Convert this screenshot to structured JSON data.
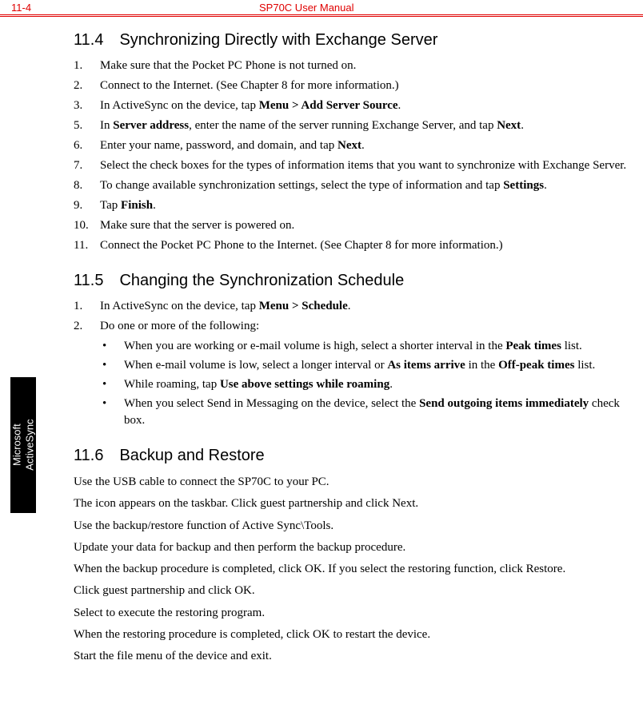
{
  "header": {
    "page_num": "11-4",
    "title": "SP70C User Manual"
  },
  "sidetab": {
    "line1": "Microsoft",
    "line2": "ActiveSync"
  },
  "s114": {
    "heading": "11.4 Synchronizing Directly with Exchange Server",
    "steps": [
      {
        "n": "1.",
        "pre": "Make sure that the Pocket PC Phone is not turned on."
      },
      {
        "n": "2.",
        "pre": "Connect to the Internet. (See Chapter 8 for more information.)"
      },
      {
        "n": "3.",
        "pre": "In ActiveSync on the device, tap ",
        "b1": "Menu > Add Server Source",
        "post1": "."
      },
      {
        "n": "5.",
        "pre": "In ",
        "b1": "Server address",
        "post1": ", enter the name of the server running Exchange Server, and tap ",
        "b2": "Next",
        "post2": "."
      },
      {
        "n": "6.",
        "pre": "Enter your name, password, and domain, and tap ",
        "b1": "Next",
        "post1": "."
      },
      {
        "n": "7.",
        "pre": "Select the check boxes for the types of information items that you want to synchronize with Exchange Server."
      },
      {
        "n": "8.",
        "pre": "To change available synchronization settings, select the type of information and tap ",
        "b1": "Settings",
        "post1": "."
      },
      {
        "n": "9.",
        "pre": "Tap ",
        "b1": "Finish",
        "post1": "."
      },
      {
        "n": "10.",
        "pre": "Make sure that the server is powered on."
      },
      {
        "n": "11.",
        "pre": "Connect the Pocket PC Phone to the Internet. (See Chapter 8 for more information.)"
      }
    ]
  },
  "s115": {
    "heading": "11.5 Changing the Synchronization Schedule",
    "steps": [
      {
        "n": "1.",
        "pre": "In ActiveSync on the device, tap ",
        "b1": "Menu > Schedule",
        "post1": "."
      },
      {
        "n": "2.",
        "pre": "Do one or more of the following:"
      }
    ],
    "bullets": [
      {
        "pre": "When you are working or e-mail volume is high, select a shorter interval in the ",
        "b1": "Peak times",
        "post1": " list."
      },
      {
        "pre": "When e-mail volume is low, select a longer interval or ",
        "b1": "As items arrive",
        "post1": " in the ",
        "b2": "Off-peak times",
        "post2": " list."
      },
      {
        "pre": "While roaming, tap ",
        "b1": "Use above settings while roaming",
        "post1": "."
      },
      {
        "pre": "When you select Send in Messaging on the device, select the ",
        "b1": "Send outgoing items immediately",
        "post1": " check box."
      }
    ]
  },
  "s116": {
    "heading": "11.6 Backup and Restore",
    "paras": [
      "Use the USB cable to connect the SP70C to your PC.",
      "The  icon appears on the taskbar. Click guest partnership and click Next.",
      "Use the backup/restore function of Active Sync\\Tools.",
      "Update your data for backup and then perform the backup procedure.",
      "When the backup procedure is completed, click OK. If you select the restoring function, click Restore.",
      "Click guest partnership and click OK.",
      "Select to execute the restoring program.",
      "When the restoring procedure is completed, click OK to restart the device.",
      "Start the file menu of the device and exit."
    ]
  }
}
